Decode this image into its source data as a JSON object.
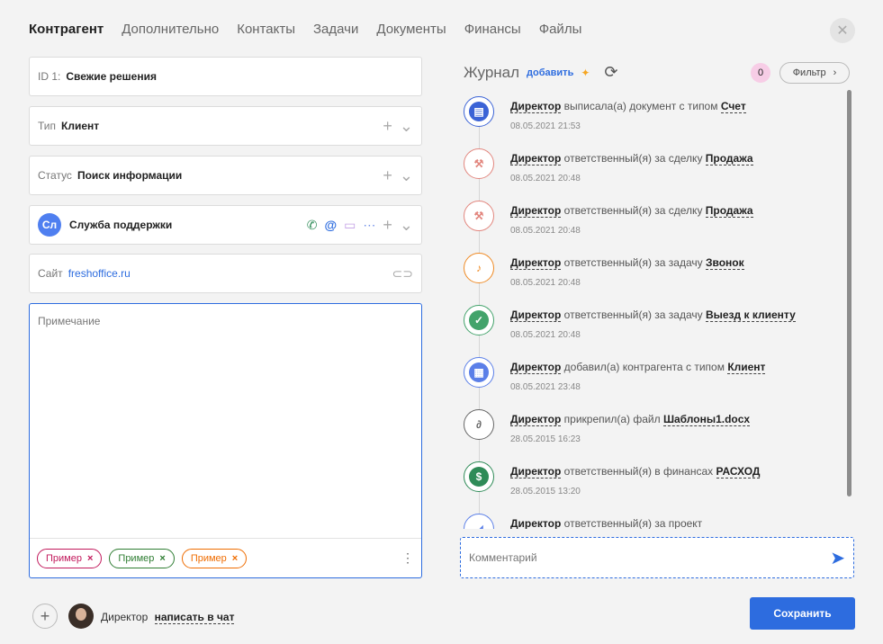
{
  "tabs": [
    {
      "label": "Контрагент",
      "active": true
    },
    {
      "label": "Дополнительно"
    },
    {
      "label": "Контакты"
    },
    {
      "label": "Задачи"
    },
    {
      "label": "Документы"
    },
    {
      "label": "Финансы"
    },
    {
      "label": "Файлы"
    }
  ],
  "form": {
    "id_label": "ID 1:",
    "id_value": "Свежие решения",
    "type_label": "Тип",
    "type_value": "Клиент",
    "status_label": "Статус",
    "status_value": "Поиск информации",
    "contact_initials": "Сл",
    "contact_name": "Служба поддержки",
    "site_label": "Сайт",
    "site_value": "freshoffice.ru",
    "note_placeholder": "Примечание",
    "tags": [
      {
        "label": "Пример",
        "color": "#c2185b"
      },
      {
        "label": "Пример",
        "color": "#2e7d32"
      },
      {
        "label": "Пример",
        "color": "#ef6c00"
      }
    ]
  },
  "journal": {
    "title": "Журнал",
    "add_label": "добавить",
    "count": "0",
    "filter_label": "Фильтр",
    "entries": [
      {
        "user": "Директор",
        "action": "выписала(а) документ с типом",
        "object": "Счет",
        "date": "08.05.2021 21:53",
        "icon": "document-icon",
        "color": "#3b63d6"
      },
      {
        "user": "Директор",
        "action": "ответственный(я) за сделку",
        "object": "Продажа",
        "date": "08.05.2021 20:48",
        "icon": "gavel-icon",
        "color": "#e2867e"
      },
      {
        "user": "Директор",
        "action": "ответственный(я) за сделку",
        "object": "Продажа",
        "date": "08.05.2021 20:48",
        "icon": "gavel-icon",
        "color": "#e2867e"
      },
      {
        "user": "Директор",
        "action": "ответственный(я) за задачу",
        "object": "Звонок",
        "date": "08.05.2021 20:48",
        "icon": "bell-icon",
        "color": "#ef8a24"
      },
      {
        "user": "Директор",
        "action": "ответственный(я) за задачу",
        "object": "Выезд к клиенту",
        "date": "08.05.2021 20:48",
        "icon": "checkbox-icon",
        "color": "#43a36b"
      },
      {
        "user": "Директор",
        "action": "добавил(а) контрагента с типом",
        "object": "Клиент",
        "date": "08.05.2021 23:48",
        "icon": "contractor-icon",
        "color": "#5b7fe8"
      },
      {
        "user": "Директор",
        "action": "прикрепил(а) файл",
        "object": "Шаблоны1.docx",
        "date": "28.05.2015 16:23",
        "icon": "paperclip-icon",
        "color": "#666666"
      },
      {
        "user": "Директор",
        "action": "ответственный(я) в финансах",
        "object": "РАСХОД",
        "date": "28.05.2015 13:20",
        "icon": "dollar-icon",
        "color": "#2e8b57"
      },
      {
        "user": "Директор",
        "action": "ответственный(я) за проект",
        "object": "",
        "date": "",
        "icon": "project-icon",
        "color": "#5b7fe8"
      }
    ]
  },
  "comment_placeholder": "Комментарий",
  "footer": {
    "user": "Директор",
    "chat_link": "написать в чат",
    "save_label": "Сохранить"
  }
}
